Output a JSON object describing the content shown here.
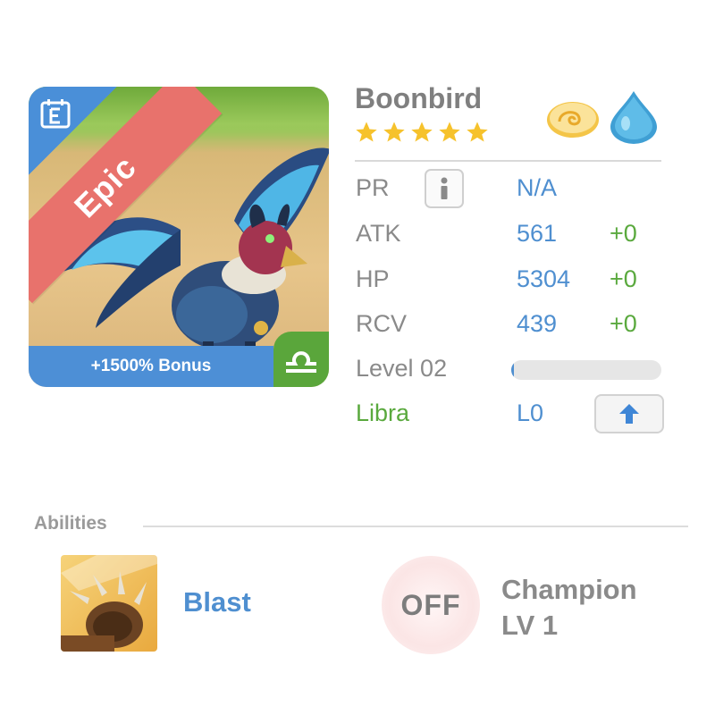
{
  "card": {
    "rarity": "Epic",
    "bonus": "+1500% Bonus",
    "icons": {
      "calendar": "calendar-e-icon",
      "zodiac": "libra-icon"
    }
  },
  "monster": {
    "name": "Boonbird",
    "stars": 5,
    "elements": [
      "wind-cloud-icon",
      "water-drop-icon"
    ]
  },
  "stats": {
    "pr": {
      "label": "PR",
      "value": "N/A"
    },
    "atk": {
      "label": "ATK",
      "value": "561",
      "bonus": "+0"
    },
    "hp": {
      "label": "HP",
      "value": "5304",
      "bonus": "+0"
    },
    "rcv": {
      "label": "RCV",
      "value": "439",
      "bonus": "+0"
    },
    "level": {
      "label": "Level 02",
      "progress": 0.02
    },
    "zodiac": {
      "label": "Libra",
      "value": "L0"
    }
  },
  "abilities": {
    "title": "Abilities",
    "skill": {
      "name": "Blast",
      "icon": "paw-claw-icon"
    },
    "champion": {
      "state": "OFF",
      "name": "Champion",
      "level": "LV 1"
    }
  },
  "colors": {
    "accent_blue": "#4f8fd0",
    "bonus_green": "#5aa93e",
    "epic_red": "#e8726c",
    "star_gold": "#f6c22c"
  }
}
